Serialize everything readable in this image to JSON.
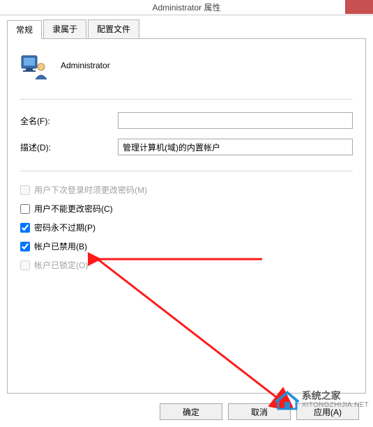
{
  "window": {
    "title": "Administrator 属性"
  },
  "tabs": {
    "general": "常规",
    "memberof": "隶属于",
    "profile": "配置文件"
  },
  "user": {
    "name": "Administrator"
  },
  "form": {
    "fullname_label": "全名(F):",
    "fullname_value": "",
    "description_label": "描述(D):",
    "description_value": "管理计算机(域)的内置帐户"
  },
  "checks": {
    "must_change": "用户下次登录时须更改密码(M)",
    "cannot_change": "用户不能更改密码(C)",
    "never_expires": "密码永不过期(P)",
    "disabled": "帐户已禁用(B)",
    "locked": "帐户已锁定(O)"
  },
  "buttons": {
    "ok": "确定",
    "cancel": "取消",
    "apply": "应用(A)"
  },
  "watermark": {
    "site_cn": "系统之家",
    "site_url": "XITONGZHIJIA.NET"
  }
}
